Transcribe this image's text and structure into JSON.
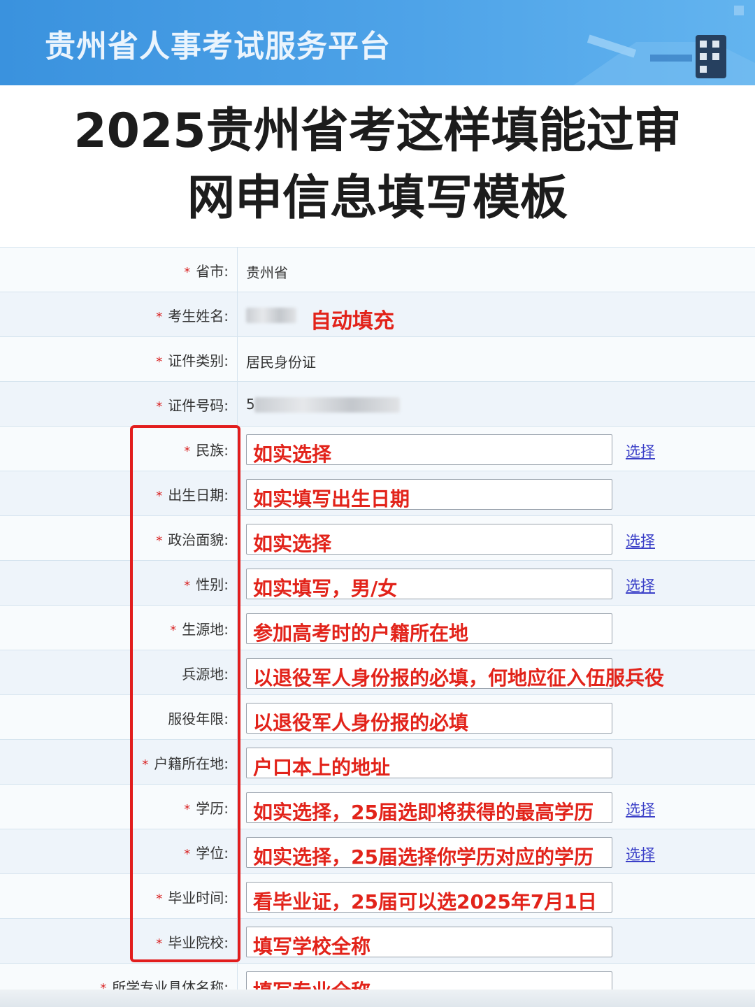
{
  "banner": {
    "title": "贵州省人事考试服务平台"
  },
  "headline": {
    "line1": "2025贵州省考这样填能过审",
    "line2": "网申信息填写模板"
  },
  "colors": {
    "banner_blue": "#3a92de",
    "annotation_red": "#e2231a",
    "link_blue": "#3b40c8"
  },
  "form": {
    "province": {
      "label": "省市:",
      "value": "贵州省"
    },
    "name": {
      "label": "考生姓名:",
      "annotation": "自动填充"
    },
    "id_type": {
      "label": "证件类别:",
      "value": "居民身份证"
    },
    "id_number": {
      "label": "证件号码:",
      "value_prefix": "5"
    },
    "fields": [
      {
        "label": "民族:",
        "value": "如实选择",
        "link": "选择",
        "required": true
      },
      {
        "label": "出生日期:",
        "value": "如实填写出生日期",
        "link": "",
        "required": true
      },
      {
        "label": "政治面貌:",
        "value": "如实选择",
        "link": "选择",
        "required": true
      },
      {
        "label": "性别:",
        "value": "如实填写，男/女",
        "link": "选择",
        "required": true
      },
      {
        "label": "生源地:",
        "value": "参加高考时的户籍所在地",
        "link": "",
        "required": true
      },
      {
        "label": "兵源地:",
        "value": "以退役军人身份报的必填，何地应征入伍服兵役",
        "link": "",
        "required": false
      },
      {
        "label": "服役年限:",
        "value": "以退役军人身份报的必填",
        "link": "",
        "required": false
      },
      {
        "label": "户籍所在地:",
        "value": "户口本上的地址",
        "link": "",
        "required": true
      },
      {
        "label": "学历:",
        "value": "如实选择，25届选即将获得的最高学历",
        "link": "选择",
        "required": true
      },
      {
        "label": "学位:",
        "value": "如实选择，25届选择你学历对应的学历",
        "link": "选择",
        "required": true
      },
      {
        "label": "毕业时间:",
        "value": "看毕业证，25届可以选2025年7月1日",
        "link": "",
        "required": true
      },
      {
        "label": "毕业院校:",
        "value": "填写学校全称",
        "link": "",
        "required": true
      },
      {
        "label": "所学专业具体名称:",
        "value": "填写专业全称",
        "link": "",
        "required": true
      }
    ]
  }
}
